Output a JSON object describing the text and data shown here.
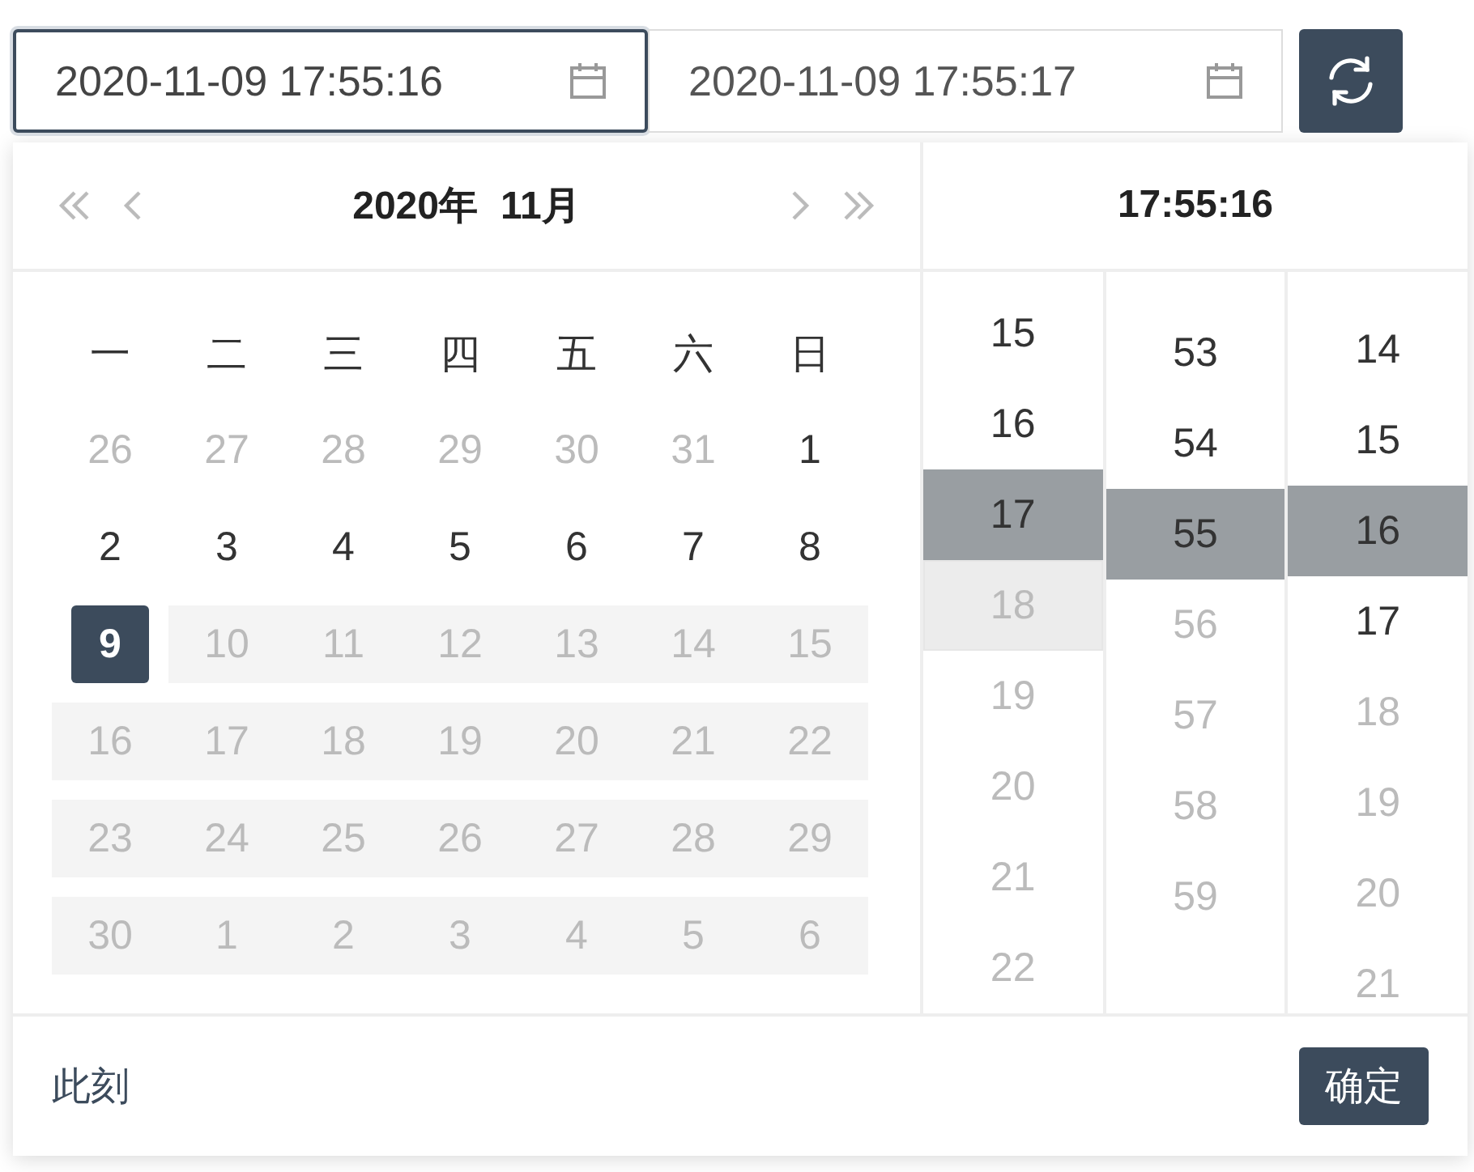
{
  "range": [
    {
      "value": "2020-11-09 17:55:16",
      "focused": true
    },
    {
      "value": "2020-11-09 17:55:17",
      "focused": false
    }
  ],
  "picker": {
    "year": "2020年",
    "month": "11月",
    "time_title": "17:55:16",
    "weekdays": [
      "一",
      "二",
      "三",
      "四",
      "五",
      "六",
      "日"
    ],
    "days": [
      {
        "day": "26",
        "kind": "other"
      },
      {
        "day": "27",
        "kind": "other"
      },
      {
        "day": "28",
        "kind": "other"
      },
      {
        "day": "29",
        "kind": "other"
      },
      {
        "day": "30",
        "kind": "other"
      },
      {
        "day": "31",
        "kind": "other"
      },
      {
        "day": "1",
        "kind": "normal"
      },
      {
        "day": "2",
        "kind": "normal"
      },
      {
        "day": "3",
        "kind": "normal"
      },
      {
        "day": "4",
        "kind": "normal"
      },
      {
        "day": "5",
        "kind": "normal"
      },
      {
        "day": "6",
        "kind": "normal"
      },
      {
        "day": "7",
        "kind": "normal"
      },
      {
        "day": "8",
        "kind": "normal"
      },
      {
        "day": "9",
        "kind": "selected"
      },
      {
        "day": "10",
        "kind": "disabled"
      },
      {
        "day": "11",
        "kind": "disabled"
      },
      {
        "day": "12",
        "kind": "disabled"
      },
      {
        "day": "13",
        "kind": "disabled"
      },
      {
        "day": "14",
        "kind": "disabled"
      },
      {
        "day": "15",
        "kind": "disabled"
      },
      {
        "day": "16",
        "kind": "disabled"
      },
      {
        "day": "17",
        "kind": "disabled"
      },
      {
        "day": "18",
        "kind": "disabled"
      },
      {
        "day": "19",
        "kind": "disabled"
      },
      {
        "day": "20",
        "kind": "disabled"
      },
      {
        "day": "21",
        "kind": "disabled"
      },
      {
        "day": "22",
        "kind": "disabled"
      },
      {
        "day": "23",
        "kind": "disabled"
      },
      {
        "day": "24",
        "kind": "disabled"
      },
      {
        "day": "25",
        "kind": "disabled"
      },
      {
        "day": "26",
        "kind": "disabled"
      },
      {
        "day": "27",
        "kind": "disabled"
      },
      {
        "day": "28",
        "kind": "disabled"
      },
      {
        "day": "29",
        "kind": "disabled"
      },
      {
        "day": "30",
        "kind": "disabled"
      },
      {
        "day": "1",
        "kind": "disabled"
      },
      {
        "day": "2",
        "kind": "disabled"
      },
      {
        "day": "3",
        "kind": "disabled"
      },
      {
        "day": "4",
        "kind": "disabled"
      },
      {
        "day": "5",
        "kind": "disabled"
      },
      {
        "day": "6",
        "kind": "disabled"
      }
    ],
    "time_columns": [
      {
        "items": [
          {
            "text": "15",
            "selected": false,
            "disabled": false,
            "hovered": false
          },
          {
            "text": "16",
            "selected": false,
            "disabled": false,
            "hovered": false
          },
          {
            "text": "17",
            "selected": true,
            "disabled": false,
            "hovered": false
          },
          {
            "text": "18",
            "selected": false,
            "disabled": true,
            "hovered": true
          },
          {
            "text": "19",
            "selected": false,
            "disabled": true,
            "hovered": false
          },
          {
            "text": "20",
            "selected": false,
            "disabled": true,
            "hovered": false
          },
          {
            "text": "21",
            "selected": false,
            "disabled": true,
            "hovered": false
          },
          {
            "text": "22",
            "selected": false,
            "disabled": true,
            "hovered": false
          }
        ]
      },
      {
        "items": [
          {
            "text": "53",
            "selected": false,
            "disabled": false,
            "hovered": false
          },
          {
            "text": "54",
            "selected": false,
            "disabled": false,
            "hovered": false
          },
          {
            "text": "55",
            "selected": true,
            "disabled": false,
            "hovered": false
          },
          {
            "text": "56",
            "selected": false,
            "disabled": true,
            "hovered": false
          },
          {
            "text": "57",
            "selected": false,
            "disabled": true,
            "hovered": false
          },
          {
            "text": "58",
            "selected": false,
            "disabled": true,
            "hovered": false
          },
          {
            "text": "59",
            "selected": false,
            "disabled": true,
            "hovered": false
          }
        ]
      },
      {
        "items": [
          {
            "text": "14",
            "selected": false,
            "disabled": false,
            "hovered": false
          },
          {
            "text": "15",
            "selected": false,
            "disabled": false,
            "hovered": false
          },
          {
            "text": "16",
            "selected": true,
            "disabled": false,
            "hovered": false
          },
          {
            "text": "17",
            "selected": false,
            "disabled": false,
            "hovered": false
          },
          {
            "text": "18",
            "selected": false,
            "disabled": true,
            "hovered": false
          },
          {
            "text": "19",
            "selected": false,
            "disabled": true,
            "hovered": false
          },
          {
            "text": "20",
            "selected": false,
            "disabled": true,
            "hovered": false
          },
          {
            "text": "21",
            "selected": false,
            "disabled": true,
            "hovered": false
          }
        ]
      }
    ],
    "now_link": "此刻",
    "confirm_button": "确定"
  }
}
